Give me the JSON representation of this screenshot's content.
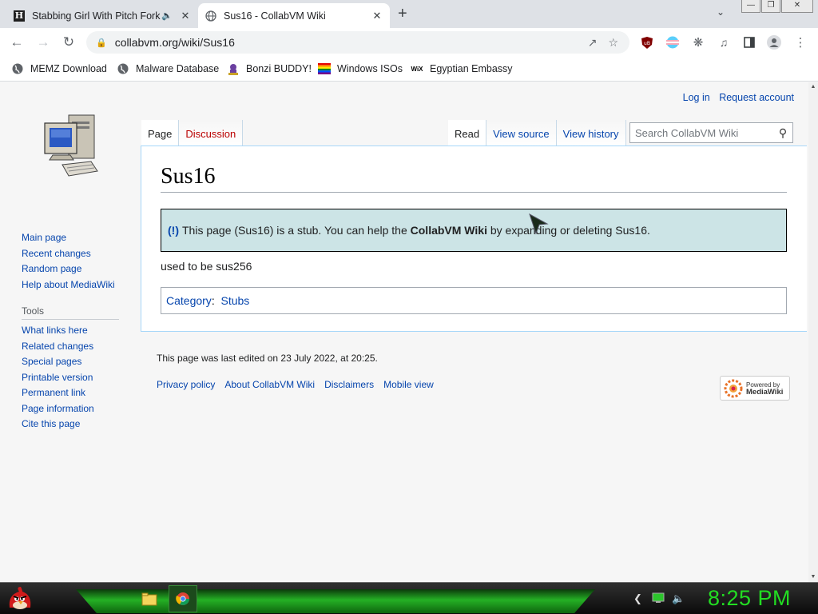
{
  "browser": {
    "tabs": [
      {
        "title": "Stabbing Girl With Pitch Fork",
        "favicon": "h-letter-icon",
        "audio": true,
        "active": false
      },
      {
        "title": "Sus16 - CollabVM Wiki",
        "favicon": "globe-icon",
        "active": true
      }
    ],
    "new_tab": "+",
    "url": "collabvm.org/wiki/Sus16",
    "bookmarks": [
      {
        "label": "MEMZ Download",
        "icon": "globe-icon"
      },
      {
        "label": "Malware Database",
        "icon": "globe-icon"
      },
      {
        "label": "Bonzi BUDDY!",
        "icon": "bonzi-icon"
      },
      {
        "label": "Windows ISOs",
        "icon": "rainbow-flag-icon"
      },
      {
        "label": "Egyptian Embassy",
        "icon": "wix-icon"
      }
    ]
  },
  "wiki": {
    "user_links": [
      "Log in",
      "Request account"
    ],
    "nav": [
      "Main page",
      "Recent changes",
      "Random page",
      "Help about MediaWiki"
    ],
    "tools_heading": "Tools",
    "tools": [
      "What links here",
      "Related changes",
      "Special pages",
      "Printable version",
      "Permanent link",
      "Page information",
      "Cite this page"
    ],
    "tabs_left": [
      "Page",
      "Discussion"
    ],
    "tabs_right": [
      "Read",
      "View source",
      "View history"
    ],
    "search_placeholder": "Search CollabVM Wiki",
    "title": "Sus16",
    "stub": {
      "marker": "(!)",
      "before": "This page (Sus16) is a stub. You can help the ",
      "bold": "CollabVM Wiki",
      "after": " by expanding or deleting Sus16."
    },
    "body": "used to be sus256",
    "category_label": "Category",
    "category": "Stubs",
    "last_edited": "This page was last edited on 23 July 2022, at 20:25.",
    "footer_links": [
      "Privacy policy",
      "About CollabVM Wiki",
      "Disclaimers",
      "Mobile view"
    ],
    "powered_by": {
      "line1": "Powered by",
      "line2": "MediaWiki"
    }
  },
  "taskbar": {
    "clock": "8:25 PM",
    "colors": {
      "accent_green": "#22dd22"
    }
  }
}
